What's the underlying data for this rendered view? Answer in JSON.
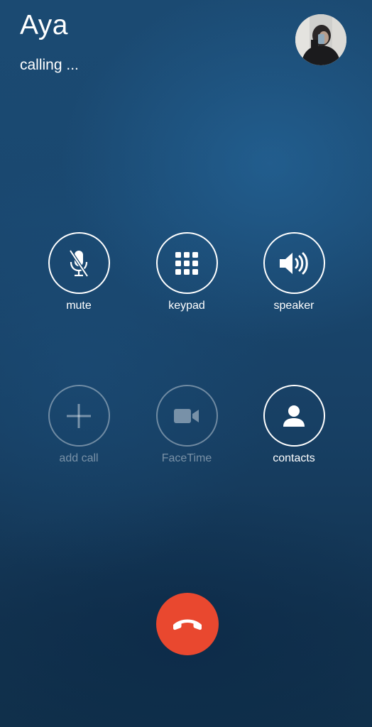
{
  "caller": {
    "name": "Aya",
    "status": "calling ..."
  },
  "controls": {
    "row1": [
      {
        "id": "mute",
        "label": "mute",
        "icon": "microphone-muted-icon",
        "enabled": true
      },
      {
        "id": "keypad",
        "label": "keypad",
        "icon": "keypad-grid-icon",
        "enabled": true
      },
      {
        "id": "speaker",
        "label": "speaker",
        "icon": "speaker-icon",
        "enabled": true
      }
    ],
    "row2": [
      {
        "id": "add_call",
        "label": "add call",
        "icon": "plus-icon",
        "enabled": false
      },
      {
        "id": "facetime",
        "label": "FaceTime",
        "icon": "video-camera-icon",
        "enabled": false
      },
      {
        "id": "contacts",
        "label": "contacts",
        "icon": "person-icon",
        "enabled": true
      }
    ]
  },
  "end_call": {
    "icon": "phone-hangup-icon",
    "color": "#e9482f"
  },
  "colors": {
    "background": "#1a4870",
    "foreground": "#ffffff",
    "disabled": "rgba(255,255,255,0.4)",
    "end_call": "#e9482f"
  }
}
